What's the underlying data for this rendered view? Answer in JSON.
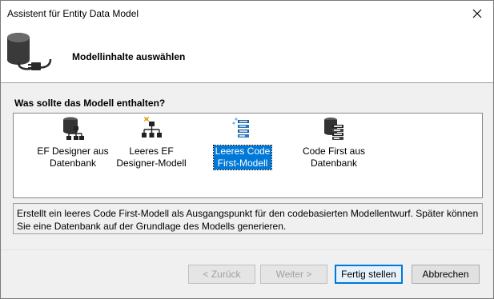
{
  "window": {
    "title": "Assistent für Entity Data Model"
  },
  "header": {
    "title": "Modellinhalte auswählen",
    "icon": "database-plug-icon"
  },
  "question": "Was sollte das Modell enthalten?",
  "options": [
    {
      "label": "EF Designer aus\nDatenbank",
      "icon": "database-hierarchy-icon",
      "selected": false
    },
    {
      "label": "Leeres EF\nDesigner-Modell",
      "icon": "empty-hierarchy-icon",
      "selected": false
    },
    {
      "label": "Leeres Code\nFirst-Modell",
      "icon": "code-first-empty-icon",
      "selected": true
    },
    {
      "label": "Code First aus\nDatenbank",
      "icon": "database-table-icon",
      "selected": false
    }
  ],
  "description": "Erstellt ein leeres Code First-Modell als Ausgangspunkt für den codebasierten Modellentwurf. Später können Sie eine Datenbank auf der Grundlage des Modells generieren.",
  "buttons": {
    "back": "< Zurück",
    "next": "Weiter >",
    "finish": "Fertig stellen",
    "cancel": "Abbrechen"
  },
  "colors": {
    "accent": "#0078d7",
    "selected_text": "#ffffff"
  }
}
